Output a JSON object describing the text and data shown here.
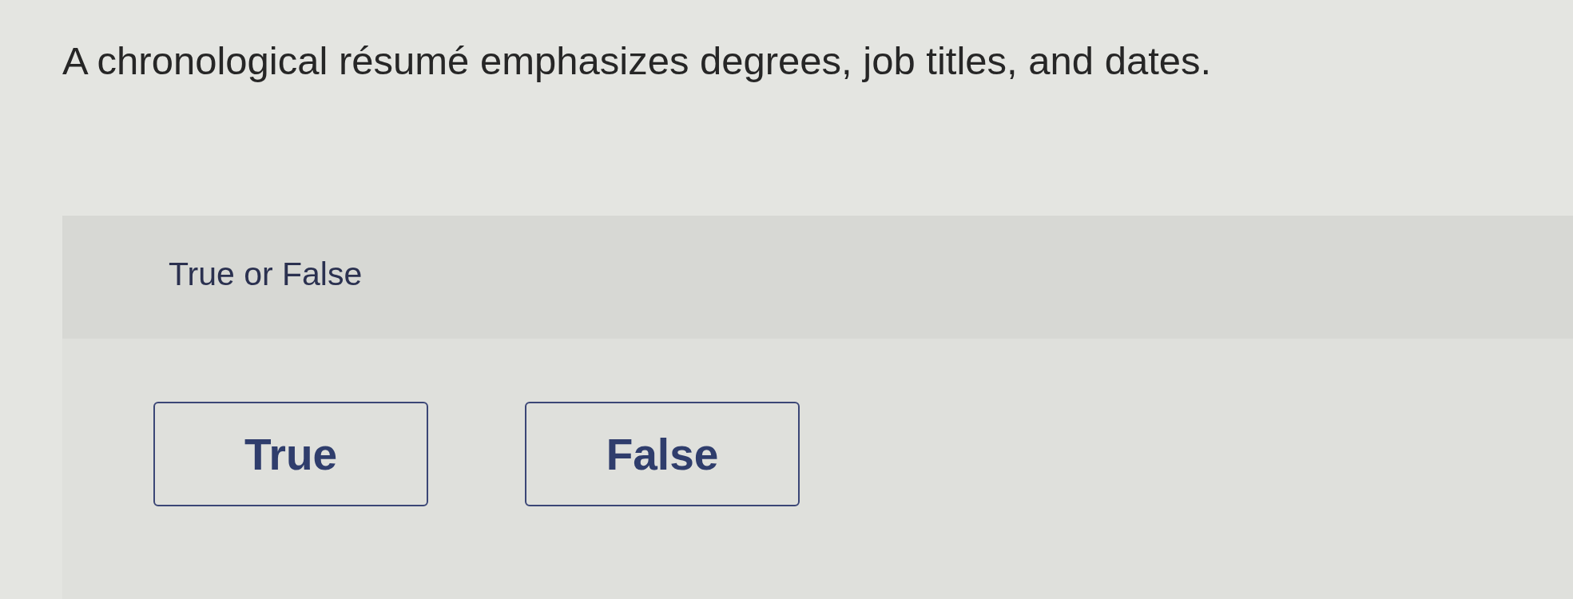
{
  "question": {
    "text": "A chronological résumé emphasizes degrees, job titles, and dates."
  },
  "answer_panel": {
    "prompt": "True or False",
    "choices": [
      {
        "label": "True",
        "selected": false
      },
      {
        "label": "False",
        "selected": false
      }
    ]
  }
}
